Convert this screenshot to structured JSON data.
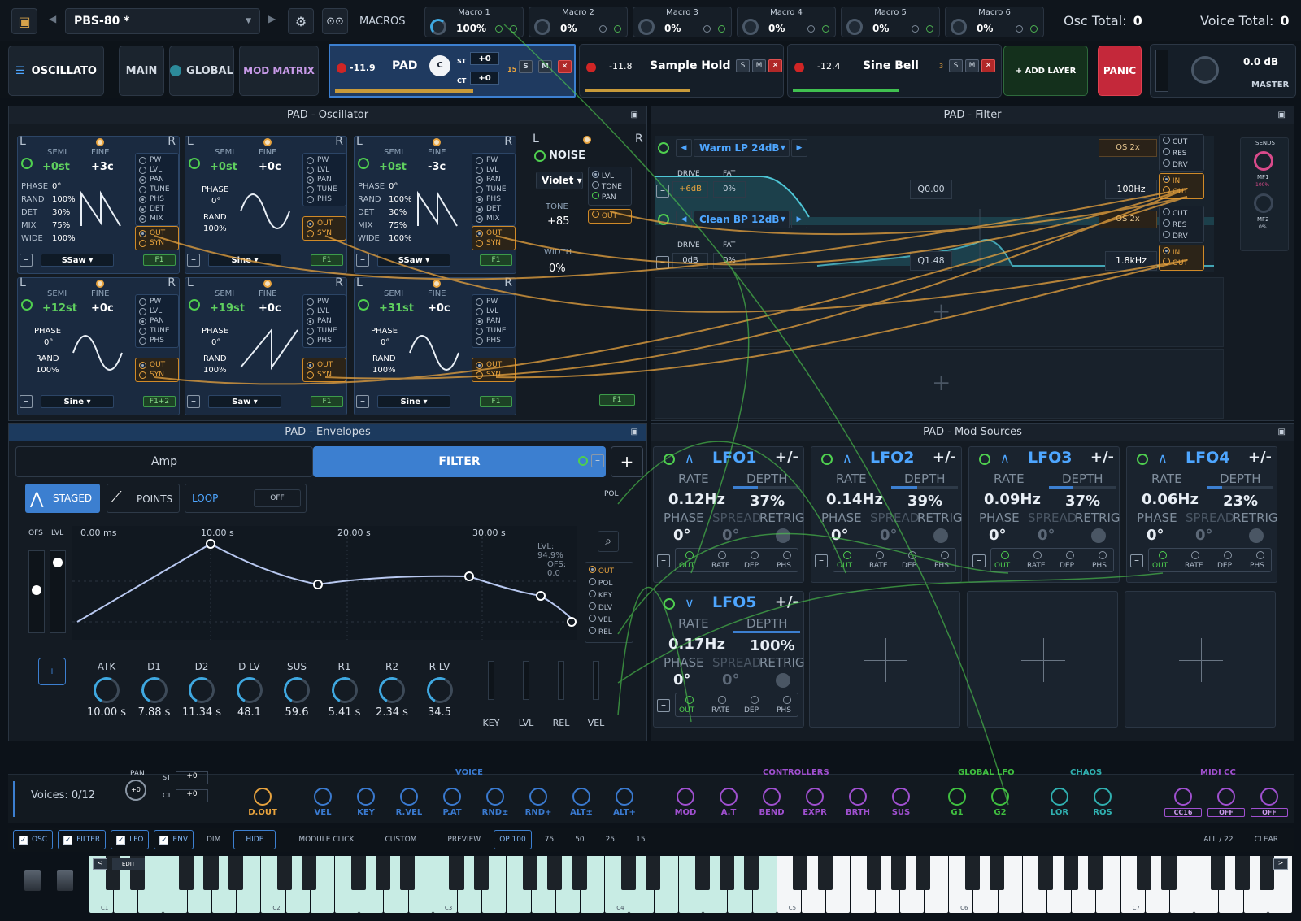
{
  "top": {
    "preset": "PBS-80 *",
    "macros_label": "MACROS",
    "macros": [
      {
        "name": "Macro 1",
        "value": "100%"
      },
      {
        "name": "Macro 2",
        "value": "0%"
      },
      {
        "name": "Macro 3",
        "value": "0%"
      },
      {
        "name": "Macro 4",
        "value": "0%"
      },
      {
        "name": "Macro 5",
        "value": "0%"
      },
      {
        "name": "Macro 6",
        "value": "0%"
      }
    ],
    "osc_total_label": "Osc Total:",
    "osc_total": "0",
    "voice_total_label": "Voice Total:",
    "voice_total": "0"
  },
  "nav": {
    "app": "OSCILLATO",
    "main": "MAIN",
    "global": "GLOBAL",
    "modmatrix": "MOD MATRIX",
    "layers": [
      {
        "db": "-11.9",
        "name": "PAD",
        "st": "+0",
        "ct": "+0",
        "knob": "C",
        "count": "15"
      },
      {
        "db": "-11.8",
        "name": "Sample Hold"
      },
      {
        "db": "-12.4",
        "name": "Sine Bell",
        "count": "3"
      }
    ],
    "s": "S",
    "m": "M",
    "x": "✕",
    "st_label": "ST",
    "ct_label": "CT",
    "add_layer": "+ ADD LAYER",
    "panic": "PANIC",
    "master_db": "0.0 dB",
    "master": "MASTER"
  },
  "osc_panel": {
    "title": "PAD - Oscillator",
    "L": "L",
    "R": "R",
    "semi_label": "SEMI",
    "fine_label": "FINE",
    "phase_label": "PHASE",
    "rand_label": "RAND",
    "det_label": "DET",
    "mix_label": "MIX",
    "wide_label": "WIDE",
    "oscs": [
      {
        "semi": "+0st",
        "fine": "+3c",
        "phase": "0°",
        "rand": "100%",
        "det": "30%",
        "mix": "75%",
        "wide": "100%",
        "wave": "SSaw",
        "route": "F1"
      },
      {
        "semi": "+0st",
        "fine": "+0c",
        "phase": "0°",
        "rand": "100%",
        "wave": "Sine",
        "route": "F1"
      },
      {
        "semi": "+0st",
        "fine": "-3c",
        "phase": "0°",
        "rand": "100%",
        "det": "30%",
        "mix": "75%",
        "wide": "100%",
        "wave": "SSaw",
        "route": "F1"
      },
      {
        "semi": "+12st",
        "fine": "+0c",
        "phase": "0°",
        "rand": "100%",
        "wave": "Sine",
        "route": "F1+2"
      },
      {
        "semi": "+19st",
        "fine": "+0c",
        "phase": "0°",
        "rand": "100%",
        "wave": "Saw",
        "route": "F1"
      },
      {
        "semi": "+31st",
        "fine": "+0c",
        "phase": "0°",
        "rand": "100%",
        "wave": "Sine",
        "route": "F1"
      }
    ],
    "opts_full": [
      "PW",
      "LVL",
      "PAN",
      "TUNE",
      "PHS",
      "DET",
      "MIX"
    ],
    "opts_short": [
      "PW",
      "LVL",
      "PAN",
      "TUNE",
      "PHS"
    ],
    "out": "OUT",
    "syn": "SYN",
    "noise": {
      "title": "NOISE",
      "color": "Violet",
      "tone_label": "TONE",
      "tone": "+85",
      "width_label": "WIDTH",
      "width": "0%",
      "opts": [
        "LVL",
        "TONE",
        "PAN"
      ],
      "route": "F1"
    }
  },
  "filter_panel": {
    "title": "PAD - Filter",
    "filters": [
      {
        "type": "Warm LP 24dB",
        "drive": "+6dB",
        "fat": "0%",
        "q": "Q0.00",
        "freq": "100Hz",
        "os": "OS 2x"
      },
      {
        "type": "Clean BP 12dB",
        "drive": "0dB",
        "fat": "0%",
        "q": "Q1.48",
        "freq": "1.8kHz",
        "os": "OS 2x"
      }
    ],
    "drive_label": "DRIVE",
    "fat_label": "FAT",
    "opts": [
      "CUT",
      "RES",
      "DRV"
    ],
    "in": "IN",
    "out": "OUT",
    "sends": "SENDS",
    "mf1": "MF1",
    "mf1_val": "100%",
    "mf2": "MF2",
    "mf2_val": "0%"
  },
  "env_panel": {
    "title": "PAD - Envelopes",
    "tab_amp": "Amp",
    "tab_filter": "FILTER",
    "staged": "STAGED",
    "points": "POINTS",
    "loop": "LOOP",
    "loop_val": "OFF",
    "ofs_label": "OFS",
    "lvl_label": "LVL",
    "time_labels": [
      "0.00 ms",
      "10.00 s",
      "20.00 s",
      "30.00 s"
    ],
    "lvl_read": "LVL: 94.9%",
    "ofs_read": "OFS: 0.0",
    "pol": "POL",
    "routes": [
      "OUT",
      "POL",
      "KEY",
      "DLV",
      "VEL",
      "REL"
    ],
    "knobs": [
      {
        "name": "ATK",
        "value": "10.00 s"
      },
      {
        "name": "D1",
        "value": "7.88 s"
      },
      {
        "name": "D2",
        "value": "11.34 s"
      },
      {
        "name": "D LV",
        "value": "48.1"
      },
      {
        "name": "SUS",
        "value": "59.6"
      },
      {
        "name": "R1",
        "value": "5.41 s"
      },
      {
        "name": "R2",
        "value": "2.34 s"
      },
      {
        "name": "R LV",
        "value": "34.5"
      }
    ],
    "sliders": [
      "KEY",
      "LVL",
      "REL",
      "VEL"
    ]
  },
  "mod_panel": {
    "title": "PAD - Mod Sources",
    "rate_label": "RATE",
    "depth_label": "DEPTH",
    "phase_label": "PHASE",
    "spread_label": "SPREAD",
    "retrig_label": "RETRIG",
    "pm": "+/-",
    "lfos": [
      {
        "name": "LFO1",
        "rate": "0.12Hz",
        "depth": "37%",
        "phase": "0°",
        "spread": "0°",
        "depth_frac": 0.37
      },
      {
        "name": "LFO2",
        "rate": "0.14Hz",
        "depth": "39%",
        "phase": "0°",
        "spread": "0°",
        "depth_frac": 0.39
      },
      {
        "name": "LFO3",
        "rate": "0.09Hz",
        "depth": "37%",
        "phase": "0°",
        "spread": "0°",
        "depth_frac": 0.37
      },
      {
        "name": "LFO4",
        "rate": "0.06Hz",
        "depth": "23%",
        "phase": "0°",
        "spread": "0°",
        "depth_frac": 0.23
      },
      {
        "name": "LFO5",
        "rate": "0.17Hz",
        "depth": "100%",
        "phase": "0°",
        "spread": "0°",
        "depth_frac": 1.0
      }
    ],
    "bottom": [
      "OUT",
      "RATE",
      "DEP",
      "PHS"
    ]
  },
  "macro_strip": {
    "voices": "Voices: 0/12",
    "pan": "PAN",
    "pan_val": "+0",
    "st": "ST",
    "ct": "CT",
    "st_val": "+0",
    "ct_val": "+0",
    "dout": "D.OUT",
    "voice_title": "VOICE",
    "voice": [
      "VEL",
      "KEY",
      "R.VEL",
      "P.AT",
      "RND±",
      "RND+",
      "ALT±",
      "ALT+"
    ],
    "ctrl_title": "CONTROLLERS",
    "ctrl": [
      "MOD",
      "A.T",
      "BEND",
      "EXPR",
      "BRTH",
      "SUS"
    ],
    "glfo_title": "GLOBAL LFO",
    "glfo": [
      "G1",
      "G2"
    ],
    "chaos_title": "CHAOS",
    "chaos": [
      "LOR",
      "ROS"
    ],
    "midi_title": "MIDI CC",
    "midi": [
      "CC16",
      "OFF",
      "OFF"
    ]
  },
  "bottombar": {
    "checks": [
      "OSC",
      "FILTER",
      "LFO",
      "ENV"
    ],
    "dim": "DIM",
    "hide": "HIDE",
    "module_click": "MODULE CLICK",
    "custom": "CUSTOM",
    "preview": "PREVIEW",
    "opacity": [
      "OP 100",
      "75",
      "50",
      "25",
      "15"
    ],
    "all": "ALL / 22",
    "clear": "CLEAR",
    "edit": "EDIT"
  },
  "keyboard": {
    "octaves": [
      "C1",
      "C2",
      "C3",
      "C4",
      "C5",
      "C6",
      "C7"
    ]
  },
  "colors": {
    "accent": "#3c7fd0",
    "mod_green": "#4fcf4f",
    "route_orange": "#e8a33e",
    "panic": "#c4283a",
    "voice": "#3a7ad0",
    "ctrl": "#a050d0",
    "glfo": "#40c040",
    "chaos": "#30b0b0"
  }
}
